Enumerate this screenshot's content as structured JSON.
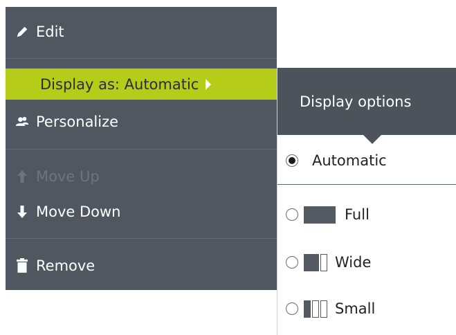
{
  "menu": {
    "items": [
      {
        "label": "Edit",
        "icon": "pencil-icon",
        "enabled": true
      },
      {
        "label": "Display as: Automatic",
        "icon": "chevron-right-icon",
        "enabled": true,
        "highlighted": true
      },
      {
        "label": "Personalize",
        "icon": "users-icon",
        "enabled": true
      },
      {
        "label": "Move Up",
        "icon": "arrow-up-icon",
        "enabled": false
      },
      {
        "label": "Move Down",
        "icon": "arrow-down-icon",
        "enabled": true
      },
      {
        "label": "Remove",
        "icon": "trash-icon",
        "enabled": true
      }
    ]
  },
  "flyout": {
    "title": "Display options",
    "options": [
      {
        "label": "Automatic",
        "selected": true
      },
      {
        "label": "Full",
        "selected": false,
        "icon": "layout-full-icon"
      },
      {
        "label": "Wide",
        "selected": false,
        "icon": "layout-wide-icon"
      },
      {
        "label": "Small",
        "selected": false,
        "icon": "layout-small-icon"
      }
    ]
  },
  "colors": {
    "menu_bg": "#515760",
    "highlight": "#b5cc18",
    "flyout_header": "#4d535b"
  }
}
